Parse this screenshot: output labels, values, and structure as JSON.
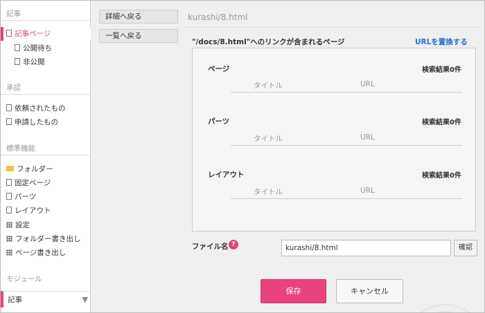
{
  "sidebar": {
    "section_articles": "記事",
    "articles_items": [
      {
        "label": "記事ページ",
        "active": true
      },
      {
        "label": "公開待ち"
      },
      {
        "label": "非公開"
      }
    ],
    "section_approval": "承認",
    "approval_items": [
      {
        "label": "依頼されたもの"
      },
      {
        "label": "申請したもの"
      }
    ],
    "section_standard": "標準機能",
    "standard_items": [
      {
        "label": "フォルダー",
        "icon": "folder-icon"
      },
      {
        "label": "固定ページ",
        "icon": "document-icon"
      },
      {
        "label": "パーツ",
        "icon": "document-icon"
      },
      {
        "label": "レイアウト",
        "icon": "document-icon"
      },
      {
        "label": "設定",
        "icon": "grid-icon"
      },
      {
        "label": "フォルダー書き出し",
        "icon": "grid-icon"
      },
      {
        "label": "ページ書き出し",
        "icon": "grid-icon"
      }
    ],
    "section_module": "モジュール",
    "module_selected": "記事"
  },
  "actions": {
    "back_detail": "詳細へ戻る",
    "back_list": "一覧へ戻る"
  },
  "header": {
    "path": "kurashi/8.html"
  },
  "links": {
    "title": "\"/docs/8.html\"へのリンクが含まれるページ",
    "replace_label": "URLを置換する",
    "groups": [
      {
        "label": "ページ",
        "count": "検索結果0件",
        "col_title": "タイトル",
        "col_url": "URL"
      },
      {
        "label": "パーツ",
        "count": "検索結果0件",
        "col_title": "タイトル",
        "col_url": "URL"
      },
      {
        "label": "レイアウト",
        "count": "検索結果0件",
        "col_title": "タイトル",
        "col_url": "URL"
      }
    ]
  },
  "filename": {
    "label": "ファイル名",
    "help": "?",
    "value": "kurashi/8.html",
    "confirm": "確認"
  },
  "footer": {
    "save": "保存",
    "cancel": "キャンセル"
  },
  "colors": {
    "accent": "#e8427f",
    "link": "#2a6ccf"
  }
}
